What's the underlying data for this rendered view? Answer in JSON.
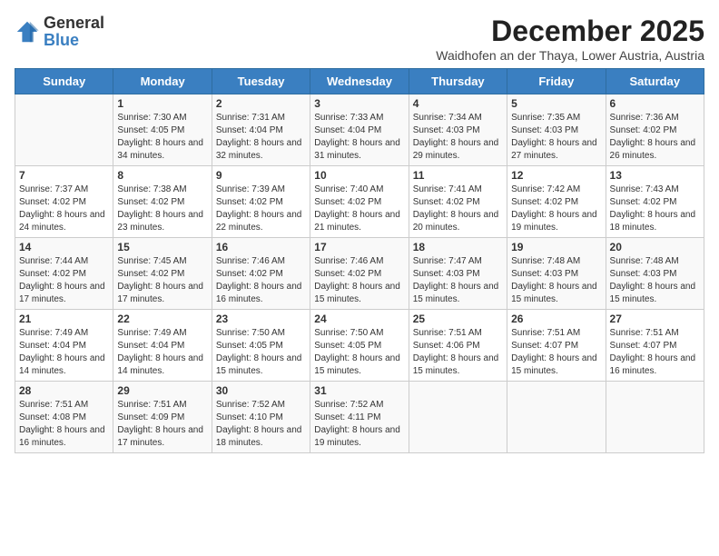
{
  "header": {
    "logo_general": "General",
    "logo_blue": "Blue",
    "month": "December 2025",
    "location": "Waidhofen an der Thaya, Lower Austria, Austria"
  },
  "weekdays": [
    "Sunday",
    "Monday",
    "Tuesday",
    "Wednesday",
    "Thursday",
    "Friday",
    "Saturday"
  ],
  "weeks": [
    [
      {
        "day": "",
        "sunrise": "",
        "sunset": "",
        "daylight": ""
      },
      {
        "day": "1",
        "sunrise": "Sunrise: 7:30 AM",
        "sunset": "Sunset: 4:05 PM",
        "daylight": "Daylight: 8 hours and 34 minutes."
      },
      {
        "day": "2",
        "sunrise": "Sunrise: 7:31 AM",
        "sunset": "Sunset: 4:04 PM",
        "daylight": "Daylight: 8 hours and 32 minutes."
      },
      {
        "day": "3",
        "sunrise": "Sunrise: 7:33 AM",
        "sunset": "Sunset: 4:04 PM",
        "daylight": "Daylight: 8 hours and 31 minutes."
      },
      {
        "day": "4",
        "sunrise": "Sunrise: 7:34 AM",
        "sunset": "Sunset: 4:03 PM",
        "daylight": "Daylight: 8 hours and 29 minutes."
      },
      {
        "day": "5",
        "sunrise": "Sunrise: 7:35 AM",
        "sunset": "Sunset: 4:03 PM",
        "daylight": "Daylight: 8 hours and 27 minutes."
      },
      {
        "day": "6",
        "sunrise": "Sunrise: 7:36 AM",
        "sunset": "Sunset: 4:02 PM",
        "daylight": "Daylight: 8 hours and 26 minutes."
      }
    ],
    [
      {
        "day": "7",
        "sunrise": "Sunrise: 7:37 AM",
        "sunset": "Sunset: 4:02 PM",
        "daylight": "Daylight: 8 hours and 24 minutes."
      },
      {
        "day": "8",
        "sunrise": "Sunrise: 7:38 AM",
        "sunset": "Sunset: 4:02 PM",
        "daylight": "Daylight: 8 hours and 23 minutes."
      },
      {
        "day": "9",
        "sunrise": "Sunrise: 7:39 AM",
        "sunset": "Sunset: 4:02 PM",
        "daylight": "Daylight: 8 hours and 22 minutes."
      },
      {
        "day": "10",
        "sunrise": "Sunrise: 7:40 AM",
        "sunset": "Sunset: 4:02 PM",
        "daylight": "Daylight: 8 hours and 21 minutes."
      },
      {
        "day": "11",
        "sunrise": "Sunrise: 7:41 AM",
        "sunset": "Sunset: 4:02 PM",
        "daylight": "Daylight: 8 hours and 20 minutes."
      },
      {
        "day": "12",
        "sunrise": "Sunrise: 7:42 AM",
        "sunset": "Sunset: 4:02 PM",
        "daylight": "Daylight: 8 hours and 19 minutes."
      },
      {
        "day": "13",
        "sunrise": "Sunrise: 7:43 AM",
        "sunset": "Sunset: 4:02 PM",
        "daylight": "Daylight: 8 hours and 18 minutes."
      }
    ],
    [
      {
        "day": "14",
        "sunrise": "Sunrise: 7:44 AM",
        "sunset": "Sunset: 4:02 PM",
        "daylight": "Daylight: 8 hours and 17 minutes."
      },
      {
        "day": "15",
        "sunrise": "Sunrise: 7:45 AM",
        "sunset": "Sunset: 4:02 PM",
        "daylight": "Daylight: 8 hours and 17 minutes."
      },
      {
        "day": "16",
        "sunrise": "Sunrise: 7:46 AM",
        "sunset": "Sunset: 4:02 PM",
        "daylight": "Daylight: 8 hours and 16 minutes."
      },
      {
        "day": "17",
        "sunrise": "Sunrise: 7:46 AM",
        "sunset": "Sunset: 4:02 PM",
        "daylight": "Daylight: 8 hours and 15 minutes."
      },
      {
        "day": "18",
        "sunrise": "Sunrise: 7:47 AM",
        "sunset": "Sunset: 4:03 PM",
        "daylight": "Daylight: 8 hours and 15 minutes."
      },
      {
        "day": "19",
        "sunrise": "Sunrise: 7:48 AM",
        "sunset": "Sunset: 4:03 PM",
        "daylight": "Daylight: 8 hours and 15 minutes."
      },
      {
        "day": "20",
        "sunrise": "Sunrise: 7:48 AM",
        "sunset": "Sunset: 4:03 PM",
        "daylight": "Daylight: 8 hours and 15 minutes."
      }
    ],
    [
      {
        "day": "21",
        "sunrise": "Sunrise: 7:49 AM",
        "sunset": "Sunset: 4:04 PM",
        "daylight": "Daylight: 8 hours and 14 minutes."
      },
      {
        "day": "22",
        "sunrise": "Sunrise: 7:49 AM",
        "sunset": "Sunset: 4:04 PM",
        "daylight": "Daylight: 8 hours and 14 minutes."
      },
      {
        "day": "23",
        "sunrise": "Sunrise: 7:50 AM",
        "sunset": "Sunset: 4:05 PM",
        "daylight": "Daylight: 8 hours and 15 minutes."
      },
      {
        "day": "24",
        "sunrise": "Sunrise: 7:50 AM",
        "sunset": "Sunset: 4:05 PM",
        "daylight": "Daylight: 8 hours and 15 minutes."
      },
      {
        "day": "25",
        "sunrise": "Sunrise: 7:51 AM",
        "sunset": "Sunset: 4:06 PM",
        "daylight": "Daylight: 8 hours and 15 minutes."
      },
      {
        "day": "26",
        "sunrise": "Sunrise: 7:51 AM",
        "sunset": "Sunset: 4:07 PM",
        "daylight": "Daylight: 8 hours and 15 minutes."
      },
      {
        "day": "27",
        "sunrise": "Sunrise: 7:51 AM",
        "sunset": "Sunset: 4:07 PM",
        "daylight": "Daylight: 8 hours and 16 minutes."
      }
    ],
    [
      {
        "day": "28",
        "sunrise": "Sunrise: 7:51 AM",
        "sunset": "Sunset: 4:08 PM",
        "daylight": "Daylight: 8 hours and 16 minutes."
      },
      {
        "day": "29",
        "sunrise": "Sunrise: 7:51 AM",
        "sunset": "Sunset: 4:09 PM",
        "daylight": "Daylight: 8 hours and 17 minutes."
      },
      {
        "day": "30",
        "sunrise": "Sunrise: 7:52 AM",
        "sunset": "Sunset: 4:10 PM",
        "daylight": "Daylight: 8 hours and 18 minutes."
      },
      {
        "day": "31",
        "sunrise": "Sunrise: 7:52 AM",
        "sunset": "Sunset: 4:11 PM",
        "daylight": "Daylight: 8 hours and 19 minutes."
      },
      {
        "day": "",
        "sunrise": "",
        "sunset": "",
        "daylight": ""
      },
      {
        "day": "",
        "sunrise": "",
        "sunset": "",
        "daylight": ""
      },
      {
        "day": "",
        "sunrise": "",
        "sunset": "",
        "daylight": ""
      }
    ]
  ]
}
